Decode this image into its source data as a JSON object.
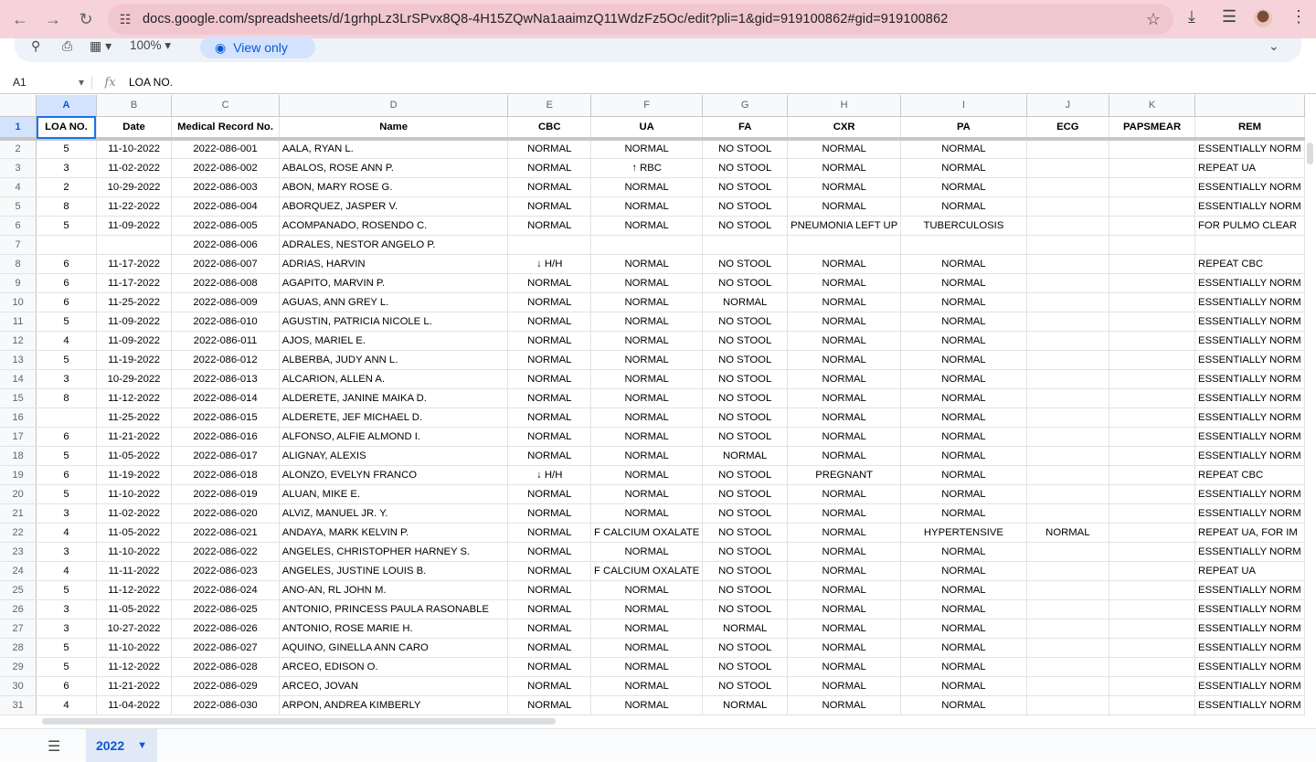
{
  "browser": {
    "url": "docs.google.com/spreadsheets/d/1grhpLz3LrSPvx8Q8-4H15ZQwNa1aaimzQ11WdzFz5Oc/edit?pli=1&gid=919100862#gid=919100862"
  },
  "toolbar": {
    "zoom": "100%",
    "view_only_label": "View only"
  },
  "formula_bar": {
    "cell_ref": "A1",
    "fx": "fx",
    "content": "LOA NO."
  },
  "columns": [
    "A",
    "B",
    "C",
    "D",
    "E",
    "F",
    "G",
    "H",
    "I",
    "J",
    "K"
  ],
  "headers": [
    "LOA NO.",
    "Date",
    "Medical Record No.",
    "Name",
    "CBC",
    "UA",
    "FA",
    "CXR",
    "PA",
    "ECG",
    "PAPSMEAR",
    "REM"
  ],
  "rows": [
    [
      "2",
      "5",
      "11-10-2022",
      "2022-086-001",
      "AALA, RYAN L.",
      "NORMAL",
      "NORMAL",
      "NO STOOL",
      "NORMAL",
      "NORMAL",
      "",
      "",
      "ESSENTIALLY NORM"
    ],
    [
      "3",
      "3",
      "11-02-2022",
      "2022-086-002",
      "ABALOS, ROSE ANN P.",
      "NORMAL",
      "↑ RBC",
      "NO STOOL",
      "NORMAL",
      "NORMAL",
      "",
      "",
      "REPEAT UA"
    ],
    [
      "4",
      "2",
      "10-29-2022",
      "2022-086-003",
      "ABON, MARY ROSE G.",
      "NORMAL",
      "NORMAL",
      "NO STOOL",
      "NORMAL",
      "NORMAL",
      "",
      "",
      "ESSENTIALLY NORM"
    ],
    [
      "5",
      "8",
      "11-22-2022",
      "2022-086-004",
      "ABORQUEZ, JASPER V.",
      "NORMAL",
      "NORMAL",
      "NO STOOL",
      "NORMAL",
      "NORMAL",
      "",
      "",
      "ESSENTIALLY NORM"
    ],
    [
      "6",
      "5",
      "11-09-2022",
      "2022-086-005",
      "ACOMPANADO, ROSENDO C.",
      "NORMAL",
      "NORMAL",
      "NO STOOL",
      "PNEUMONIA LEFT UP",
      "TUBERCULOSIS",
      "",
      "",
      "FOR PULMO CLEAR"
    ],
    [
      "7",
      "",
      "",
      "2022-086-006",
      "ADRALES, NESTOR ANGELO P.",
      "",
      "",
      "",
      "",
      "",
      "",
      "",
      ""
    ],
    [
      "8",
      "6",
      "11-17-2022",
      "2022-086-007",
      "ADRIAS, HARVIN",
      "↓ H/H",
      "NORMAL",
      "NO STOOL",
      "NORMAL",
      "NORMAL",
      "",
      "",
      "REPEAT CBC"
    ],
    [
      "9",
      "6",
      "11-17-2022",
      "2022-086-008",
      "AGAPITO, MARVIN P.",
      "NORMAL",
      "NORMAL",
      "NO STOOL",
      "NORMAL",
      "NORMAL",
      "",
      "",
      "ESSENTIALLY NORM"
    ],
    [
      "10",
      "6",
      "11-25-2022",
      "2022-086-009",
      "AGUAS, ANN GREY L.",
      "NORMAL",
      "NORMAL",
      "NORMAL",
      "NORMAL",
      "NORMAL",
      "",
      "",
      "ESSENTIALLY NORM"
    ],
    [
      "11",
      "5",
      "11-09-2022",
      "2022-086-010",
      "AGUSTIN, PATRICIA NICOLE L.",
      "NORMAL",
      "NORMAL",
      "NO STOOL",
      "NORMAL",
      "NORMAL",
      "",
      "",
      "ESSENTIALLY NORM"
    ],
    [
      "12",
      "4",
      "11-09-2022",
      "2022-086-011",
      "AJOS, MARIEL E.",
      "NORMAL",
      "NORMAL",
      "NO STOOL",
      "NORMAL",
      "NORMAL",
      "",
      "",
      "ESSENTIALLY NORM"
    ],
    [
      "13",
      "5",
      "11-19-2022",
      "2022-086-012",
      "ALBERBA, JUDY ANN L.",
      "NORMAL",
      "NORMAL",
      "NO STOOL",
      "NORMAL",
      "NORMAL",
      "",
      "",
      "ESSENTIALLY NORM"
    ],
    [
      "14",
      "3",
      "10-29-2022",
      "2022-086-013",
      "ALCARION, ALLEN A.",
      "NORMAL",
      "NORMAL",
      "NO STOOL",
      "NORMAL",
      "NORMAL",
      "",
      "",
      "ESSENTIALLY NORM"
    ],
    [
      "15",
      "8",
      "11-12-2022",
      "2022-086-014",
      "ALDERETE, JANINE MAIKA D.",
      "NORMAL",
      "NORMAL",
      "NO STOOL",
      "NORMAL",
      "NORMAL",
      "",
      "",
      "ESSENTIALLY NORM"
    ],
    [
      "16",
      "",
      "11-25-2022",
      "2022-086-015",
      "ALDERETE, JEF MICHAEL D.",
      "NORMAL",
      "NORMAL",
      "NO STOOL",
      "NORMAL",
      "NORMAL",
      "",
      "",
      "ESSENTIALLY NORM"
    ],
    [
      "17",
      "6",
      "11-21-2022",
      "2022-086-016",
      "ALFONSO, ALFIE ALMOND I.",
      "NORMAL",
      "NORMAL",
      "NO STOOL",
      "NORMAL",
      "NORMAL",
      "",
      "",
      "ESSENTIALLY NORM"
    ],
    [
      "18",
      "5",
      "11-05-2022",
      "2022-086-017",
      "ALIGNAY, ALEXIS",
      "NORMAL",
      "NORMAL",
      "NORMAL",
      "NORMAL",
      "NORMAL",
      "",
      "",
      "ESSENTIALLY NORM"
    ],
    [
      "19",
      "6",
      "11-19-2022",
      "2022-086-018",
      "ALONZO, EVELYN FRANCO",
      "↓ H/H",
      "NORMAL",
      "NO STOOL",
      "PREGNANT",
      "NORMAL",
      "",
      "",
      "REPEAT CBC"
    ],
    [
      "20",
      "5",
      "11-10-2022",
      "2022-086-019",
      "ALUAN, MIKE E.",
      "NORMAL",
      "NORMAL",
      "NO STOOL",
      "NORMAL",
      "NORMAL",
      "",
      "",
      "ESSENTIALLY NORM"
    ],
    [
      "21",
      "3",
      "11-02-2022",
      "2022-086-020",
      "ALVIZ, MANUEL JR. Y.",
      "NORMAL",
      "NORMAL",
      "NO STOOL",
      "NORMAL",
      "NORMAL",
      "",
      "",
      "ESSENTIALLY NORM"
    ],
    [
      "22",
      "4",
      "11-05-2022",
      "2022-086-021",
      "ANDAYA, MARK KELVIN P.",
      "NORMAL",
      "F CALCIUM OXALATE",
      "NO STOOL",
      "NORMAL",
      "HYPERTENSIVE",
      "NORMAL",
      "",
      "REPEAT UA, FOR IM"
    ],
    [
      "23",
      "3",
      "11-10-2022",
      "2022-086-022",
      "ANGELES, CHRISTOPHER HARNEY S.",
      "NORMAL",
      "NORMAL",
      "NO STOOL",
      "NORMAL",
      "NORMAL",
      "",
      "",
      "ESSENTIALLY NORM"
    ],
    [
      "24",
      "4",
      "11-11-2022",
      "2022-086-023",
      "ANGELES, JUSTINE LOUIS B.",
      "NORMAL",
      "F CALCIUM OXALATE",
      "NO STOOL",
      "NORMAL",
      "NORMAL",
      "",
      "",
      "REPEAT UA"
    ],
    [
      "25",
      "5",
      "11-12-2022",
      "2022-086-024",
      "ANO-AN, RL JOHN M.",
      "NORMAL",
      "NORMAL",
      "NO STOOL",
      "NORMAL",
      "NORMAL",
      "",
      "",
      "ESSENTIALLY NORM"
    ],
    [
      "26",
      "3",
      "11-05-2022",
      "2022-086-025",
      "ANTONIO, PRINCESS PAULA RASONABLE",
      "NORMAL",
      "NORMAL",
      "NO STOOL",
      "NORMAL",
      "NORMAL",
      "",
      "",
      "ESSENTIALLY NORM"
    ],
    [
      "27",
      "3",
      "10-27-2022",
      "2022-086-026",
      "ANTONIO, ROSE MARIE H.",
      "NORMAL",
      "NORMAL",
      "NORMAL",
      "NORMAL",
      "NORMAL",
      "",
      "",
      "ESSENTIALLY NORM"
    ],
    [
      "28",
      "5",
      "11-10-2022",
      "2022-086-027",
      "AQUINO, GINELLA ANN CARO",
      "NORMAL",
      "NORMAL",
      "NO STOOL",
      "NORMAL",
      "NORMAL",
      "",
      "",
      "ESSENTIALLY NORM"
    ],
    [
      "29",
      "5",
      "11-12-2022",
      "2022-086-028",
      "ARCEO, EDISON O.",
      "NORMAL",
      "NORMAL",
      "NO STOOL",
      "NORMAL",
      "NORMAL",
      "",
      "",
      "ESSENTIALLY NORM"
    ],
    [
      "30",
      "6",
      "11-21-2022",
      "2022-086-029",
      "ARCEO, JOVAN",
      "NORMAL",
      "NORMAL",
      "NO STOOL",
      "NORMAL",
      "NORMAL",
      "",
      "",
      "ESSENTIALLY NORM"
    ],
    [
      "31",
      "4",
      "11-04-2022",
      "2022-086-030",
      "ARPON, ANDREA KIMBERLY",
      "NORMAL",
      "NORMAL",
      "NORMAL",
      "NORMAL",
      "NORMAL",
      "",
      "",
      "ESSENTIALLY NORM"
    ]
  ],
  "sheet_tab": {
    "label": "2022"
  }
}
